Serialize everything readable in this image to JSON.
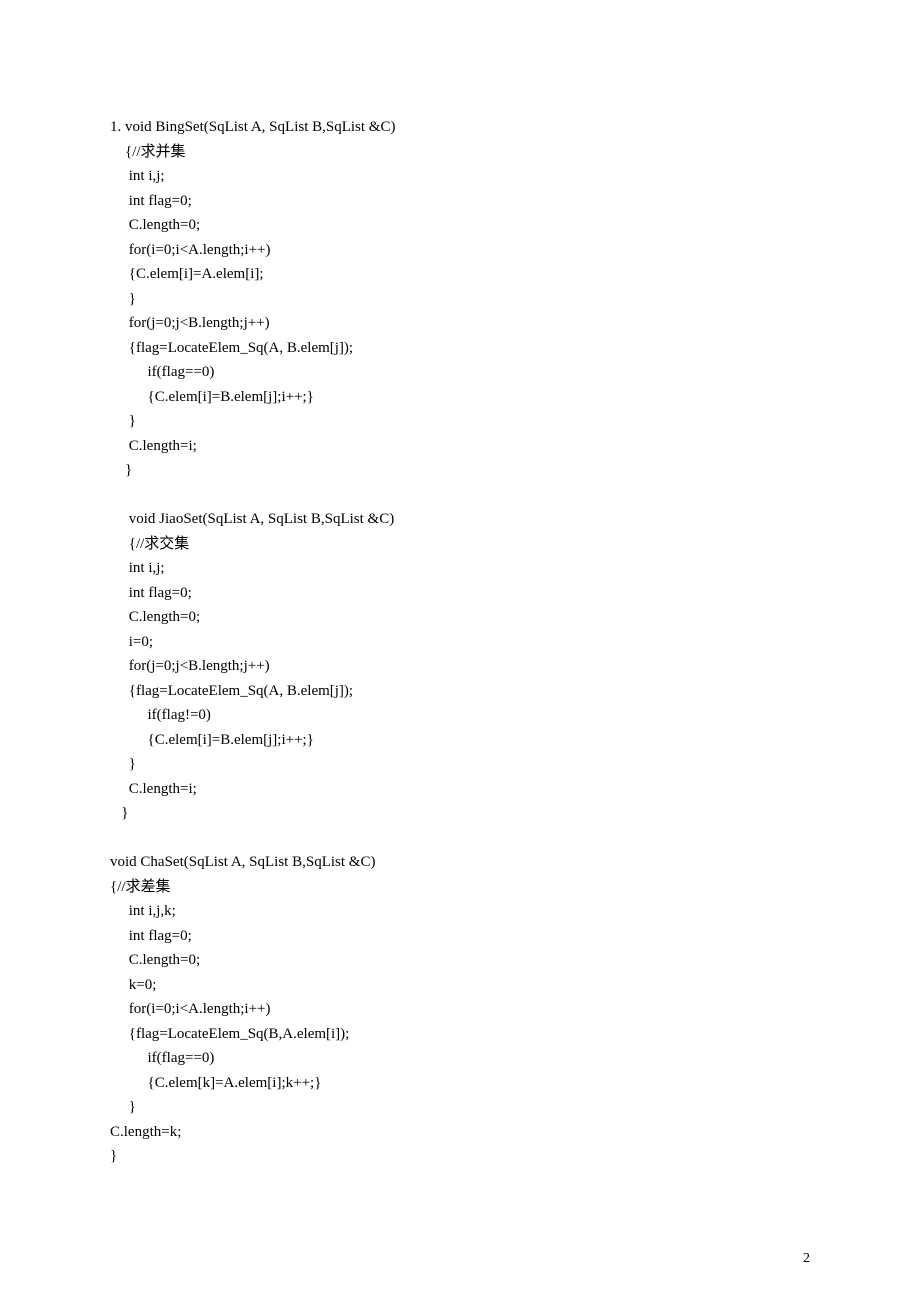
{
  "lines": [
    "1. void BingSet(SqList A, SqList B,SqList &C)",
    "    {//求并集",
    "     int i,j;",
    "     int flag=0;",
    "     C.length=0;",
    "     for(i=0;i<A.length;i++)",
    "     {C.elem[i]=A.elem[i];",
    "     }",
    "     for(j=0;j<B.length;j++)",
    "     {flag=LocateElem_Sq(A, B.elem[j]);",
    "          if(flag==0)",
    "          {C.elem[i]=B.elem[j];i++;}",
    "     }",
    "     C.length=i;",
    "    }",
    "",
    "     void JiaoSet(SqList A, SqList B,SqList &C)",
    "     {//求交集",
    "     int i,j;",
    "     int flag=0;",
    "     C.length=0;",
    "     i=0;",
    "     for(j=0;j<B.length;j++)",
    "     {flag=LocateElem_Sq(A, B.elem[j]);",
    "          if(flag!=0)",
    "          {C.elem[i]=B.elem[j];i++;}",
    "     }",
    "     C.length=i;",
    "   }",
    "",
    "void ChaSet(SqList A, SqList B,SqList &C)",
    "{//求差集",
    "     int i,j,k;",
    "     int flag=0;",
    "     C.length=0;",
    "     k=0;",
    "     for(i=0;i<A.length;i++)",
    "     {flag=LocateElem_Sq(B,A.elem[i]);",
    "          if(flag==0)",
    "          {C.elem[k]=A.elem[i];k++;}",
    "     }",
    "C.length=k;",
    "}"
  ],
  "pageNumber": "2"
}
